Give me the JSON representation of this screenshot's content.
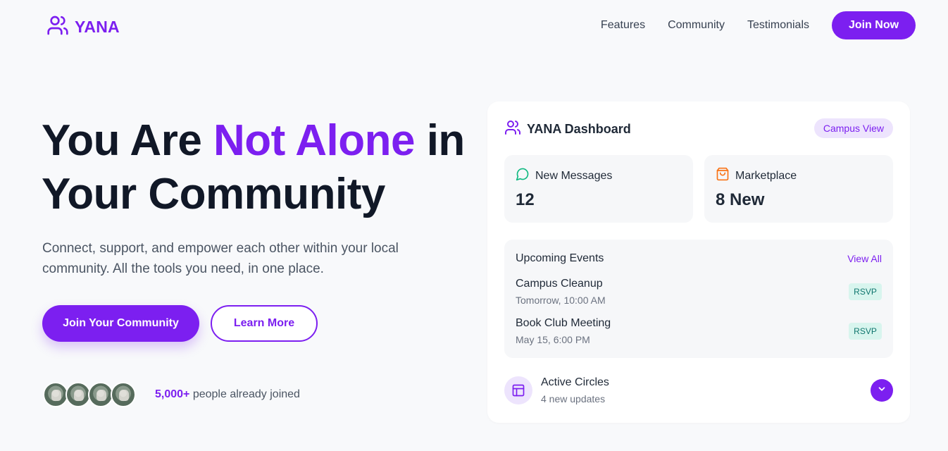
{
  "brand": {
    "name": "YANA",
    "logo_icon": "users-icon",
    "accent": "#7c1ff0"
  },
  "nav": {
    "links": [
      "Features",
      "Community",
      "Testimonials"
    ],
    "cta": "Join Now"
  },
  "hero": {
    "title_part1": "You Are ",
    "title_accent": "Not Alone",
    "title_part2": " in Your Community",
    "subtitle": "Connect, support, and empower each other within your local community. All the tools you need, in one place.",
    "primary_button": "Join Your Community",
    "secondary_button": "Learn More",
    "joined_count": "5,000+",
    "joined_text": " people already joined"
  },
  "dashboard": {
    "title": "YANA Dashboard",
    "view_chip": "Campus View",
    "stats": [
      {
        "icon": "message-circle-icon",
        "label": "New Messages",
        "value": "12"
      },
      {
        "icon": "shopping-bag-icon",
        "label": "Marketplace",
        "value": "8 New"
      }
    ],
    "events": {
      "title": "Upcoming Events",
      "view_all": "View All",
      "items": [
        {
          "name": "Campus Cleanup",
          "time": "Tomorrow, 10:00 AM",
          "action": "RSVP"
        },
        {
          "name": "Book Club Meeting",
          "time": "May 15, 6:00 PM",
          "action": "RSVP"
        }
      ]
    },
    "circles": {
      "icon": "layout-icon",
      "title": "Active Circles",
      "subtitle": "4 new updates"
    }
  }
}
